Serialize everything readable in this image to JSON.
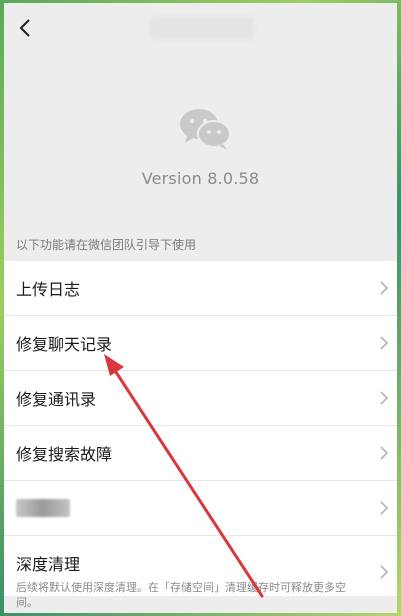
{
  "topbar": {
    "back_icon": "chevron-left-icon"
  },
  "about": {
    "logo_icon": "wechat-logo-icon",
    "version": "Version 8.0.58"
  },
  "section": {
    "hint": "以下功能请在微信团队引导下使用"
  },
  "menu": {
    "items": [
      {
        "label": "上传日志"
      },
      {
        "label": "修复聊天记录"
      },
      {
        "label": "修复通讯录"
      },
      {
        "label": "修复搜索故障"
      },
      {
        "label": ""
      },
      {
        "label": "深度清理",
        "description": "后续将默认使用深度清理。在「存储空间」清理缓存时可释放更多空间。"
      }
    ]
  },
  "annotation": {
    "arrow_color": "#d9363e",
    "target": "修复聊天记录"
  }
}
